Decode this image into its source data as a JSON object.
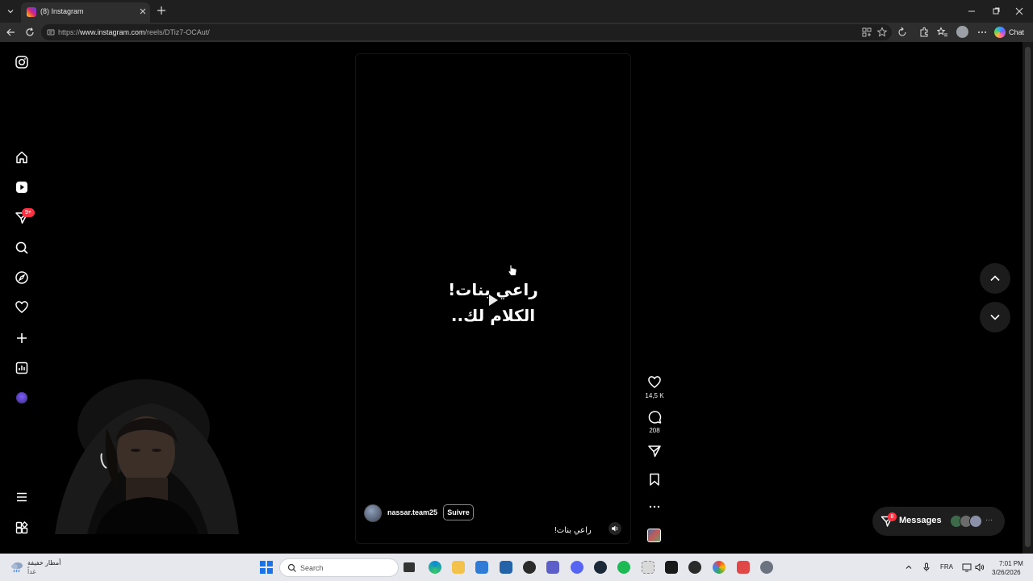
{
  "browser": {
    "tab_title": "(8) Instagram",
    "url_prefix": "https://",
    "url_host": "www.instagram.com",
    "url_path": "/reels/DTiz7-OCAut/",
    "chat_label": "Chat"
  },
  "sidebar": {
    "icons": [
      "instagram-logo-icon",
      "home-icon",
      "reels-icon",
      "direct-messages-icon",
      "search-icon",
      "explore-icon",
      "notifications-heart-icon",
      "create-plus-icon",
      "dashboard-icon",
      "profile-avatar",
      "more-menu-icon",
      "also-from-meta-icon"
    ],
    "messages_badge": "9+"
  },
  "reel": {
    "overlay_line1": "راعي بنات!",
    "overlay_line2": "الكلام لك..",
    "username": "nassar.team25",
    "follow_label": "Suivre",
    "caption": "راعي بنات!"
  },
  "actions": {
    "likes": "14,5 K",
    "comments": "208"
  },
  "messages": {
    "label": "Messages",
    "badge": "8",
    "more": "···"
  },
  "taskbar": {
    "weather_line1": "أمطار خفيفة",
    "weather_line2": "غداً",
    "search_placeholder": "Search",
    "language": "FRA",
    "time": "7:01 PM",
    "date": "3/26/2026"
  }
}
